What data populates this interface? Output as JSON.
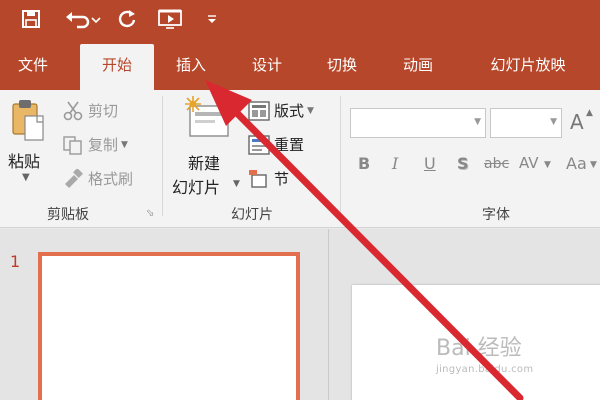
{
  "quick_access": {
    "icons": [
      "save-icon",
      "undo-icon",
      "redo-icon",
      "start-from-beginning-icon",
      "customize-qat-icon"
    ]
  },
  "tabs": [
    {
      "label": "文件",
      "active": false
    },
    {
      "label": "开始",
      "active": true
    },
    {
      "label": "插入",
      "active": false
    },
    {
      "label": "设计",
      "active": false
    },
    {
      "label": "切换",
      "active": false
    },
    {
      "label": "动画",
      "active": false
    },
    {
      "label": "幻灯片放映",
      "active": false
    }
  ],
  "clipboard": {
    "paste": "粘贴",
    "cut": "剪切",
    "copy": "复制",
    "format_painter": "格式刷",
    "group_label": "剪贴板"
  },
  "slides": {
    "new_slide_line1": "新建",
    "new_slide_line2": "幻灯片",
    "layout": "版式",
    "reset": "重置",
    "section": "节",
    "group_label": "幻灯片"
  },
  "font": {
    "font_name": "",
    "font_size": "",
    "bold": "B",
    "italic": "I",
    "underline": "U",
    "shadow": "S",
    "strikethrough": "abc",
    "spacing": "AV",
    "change_case": "Aa",
    "grow": "A",
    "group_label": "字体"
  },
  "slide_panel": {
    "slide_number": "1"
  },
  "watermark": {
    "brand": "Bai 经验",
    "url": "jingyan.baidu.com"
  },
  "colors": {
    "accent": "#b7472a",
    "thumb_border": "#e2704f",
    "arrow": "#d9282f"
  }
}
